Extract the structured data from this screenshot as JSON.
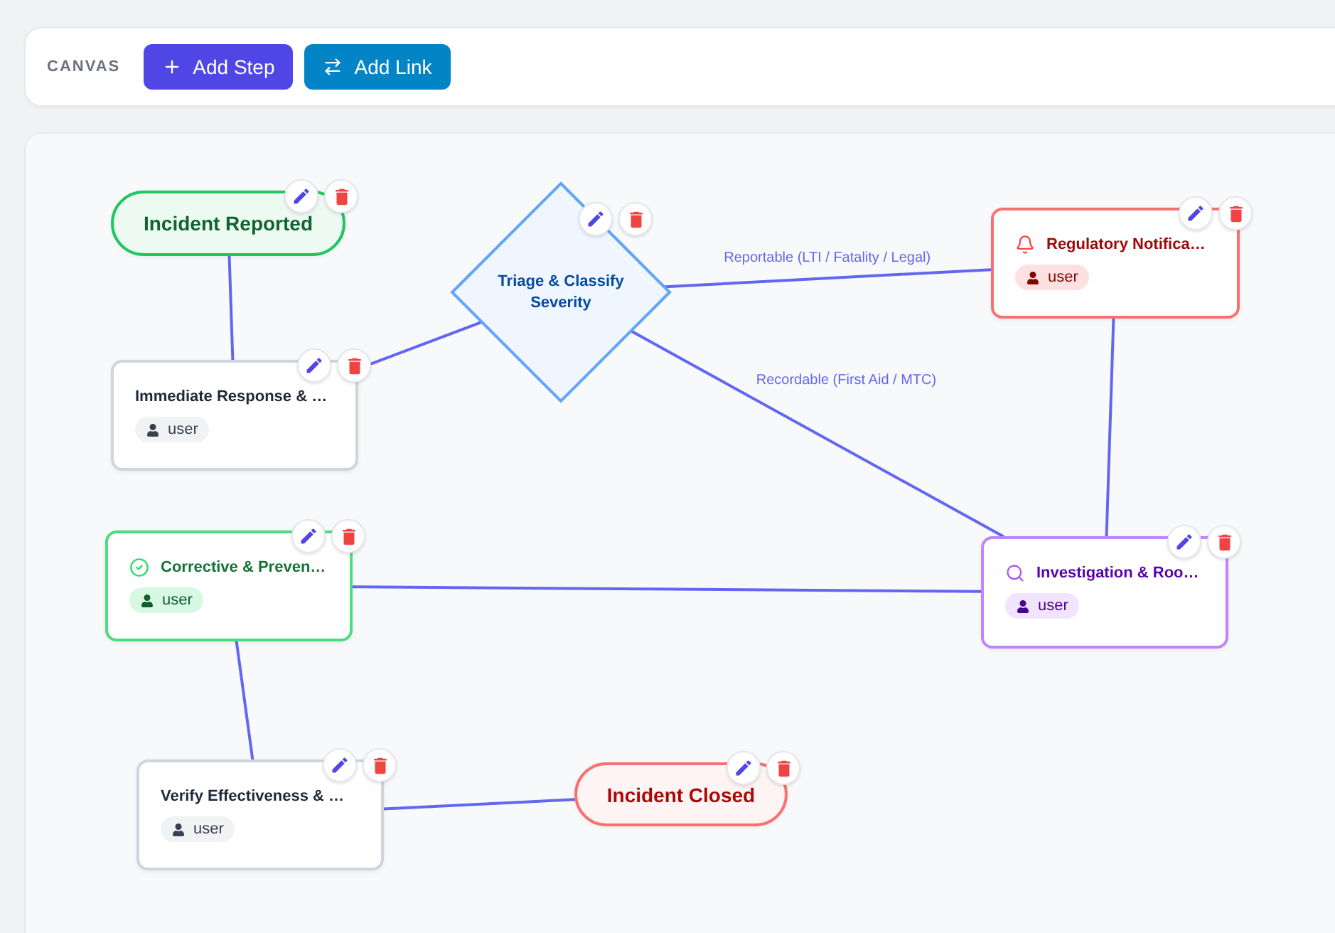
{
  "toolbar": {
    "title": "CANVAS",
    "buttons": [
      {
        "kind": "add",
        "label": "Add Step"
      },
      {
        "kind": "link",
        "label": "Add Link"
      }
    ]
  },
  "canvas": {
    "nodes": [
      {
        "kind": "terminal",
        "title": "Incident Reported",
        "color": "#22c55e"
      },
      {
        "kind": "decision",
        "title": "Triage & Classify Severity",
        "color": "#60a5fa"
      },
      {
        "kind": "alert",
        "title": "Regulatory Notifica…",
        "assignee": "user",
        "color": "#f87171"
      },
      {
        "kind": "task",
        "title": "Immediate Response & …",
        "assignee": "user"
      },
      {
        "kind": "action",
        "title": "Corrective & Preven…",
        "assignee": "user",
        "color": "#4ade80"
      },
      {
        "kind": "inquiry",
        "title": "Investigation & Roo…",
        "assignee": "user",
        "color": "#c084fc"
      },
      {
        "kind": "task",
        "title": "Verify Effectiveness & …",
        "assignee": "user"
      },
      {
        "kind": "terminal",
        "title": "Incident Closed",
        "color": "#f87171"
      }
    ],
    "edge_labels": [
      "Reportable (LTI / Fatality / Legal)",
      "Recordable (First Aid / MTC)"
    ]
  }
}
